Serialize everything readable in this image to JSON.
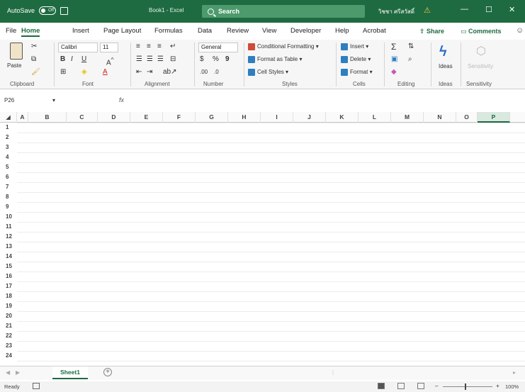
{
  "titlebar": {
    "autosave_label": "AutoSave",
    "autosave_state": "Off",
    "doc_title": "Book1 - Excel",
    "search_label": "Search",
    "user_name": "วิชชา ศรีสวัสดิ์",
    "minimize": "—",
    "maximize": "☐",
    "close": "✕"
  },
  "tabs": [
    "File",
    "Home",
    "Insert",
    "Page Layout",
    "Formulas",
    "Data",
    "Review",
    "View",
    "Developer",
    "Help",
    "Acrobat"
  ],
  "active_tab": "Home",
  "share_label": "Share",
  "comments_label": "Comments",
  "ribbon": {
    "paste_label": "Paste",
    "font_name": "Calibri",
    "font_size": "11",
    "number_format": "General",
    "conditional_formatting": "Conditional Formatting",
    "format_as_table": "Format as Table",
    "cell_styles": "Cell Styles",
    "insert": "Insert",
    "delete": "Delete",
    "format": "Format",
    "ideas": "Ideas",
    "sensitivity": "Sensitivity",
    "groups": {
      "clipboard": "Clipboard",
      "font": "Font",
      "alignment": "Alignment",
      "number": "Number",
      "styles": "Styles",
      "cells": "Cells",
      "editing": "Editing",
      "ideas": "Ideas",
      "sensitivity": "Sensitivity"
    }
  },
  "formula_bar": {
    "name_box": "P26",
    "fx": "fx"
  },
  "columns": [
    "A",
    "B",
    "C",
    "D",
    "E",
    "F",
    "G",
    "H",
    "I",
    "J",
    "K",
    "L",
    "M",
    "N",
    "O",
    "P"
  ],
  "selected_column": "P",
  "rows": [
    "1",
    "2",
    "3",
    "4",
    "5",
    "6",
    "7",
    "8",
    "9",
    "10",
    "11",
    "12",
    "13",
    "14",
    "15",
    "16",
    "17",
    "18",
    "19",
    "20",
    "21",
    "22",
    "23",
    "24"
  ],
  "sheet_tab": "Sheet1",
  "add_sheet": "+",
  "status": "Ready",
  "zoom": "100%"
}
